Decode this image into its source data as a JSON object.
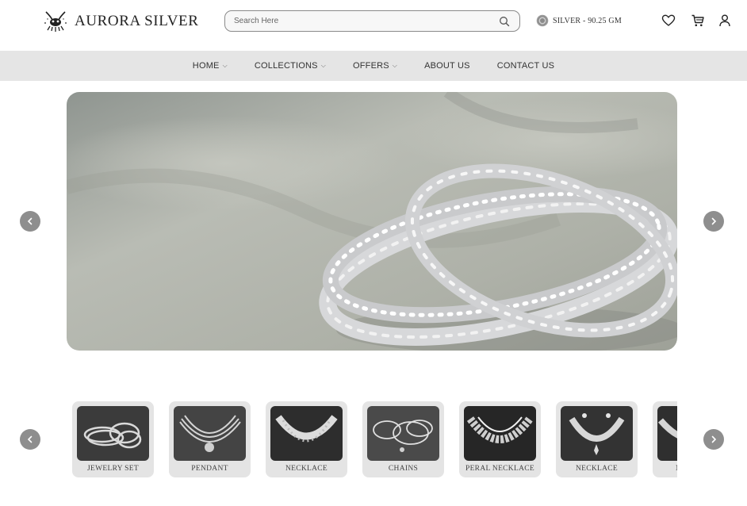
{
  "brand": {
    "name": "AURORA SILVER"
  },
  "search": {
    "placeholder": "Search Here"
  },
  "silver_rate": {
    "label": "SILVER - 90.25 GM"
  },
  "header_icons": [
    "heart-icon",
    "cart-icon",
    "user-icon"
  ],
  "nav": {
    "items": [
      {
        "label": "HOME",
        "dropdown": true
      },
      {
        "label": "COLLECTIONS",
        "dropdown": true
      },
      {
        "label": "OFFERS",
        "dropdown": true
      },
      {
        "label": "ABOUT US",
        "dropdown": false
      },
      {
        "label": "CONTACT US",
        "dropdown": false
      }
    ]
  },
  "categories": [
    {
      "label": "JEWELRY SET"
    },
    {
      "label": "PENDANT"
    },
    {
      "label": "NECKLACE"
    },
    {
      "label": "CHAINS"
    },
    {
      "label": "PERAL NECKLACE"
    },
    {
      "label": "NECKLACE"
    },
    {
      "label": "NOSE PIN"
    }
  ],
  "colors": {
    "nav_bg": "#e5e5e5",
    "card_bg": "#e4e4e4",
    "arrow_bg": "#8e8e8e"
  }
}
